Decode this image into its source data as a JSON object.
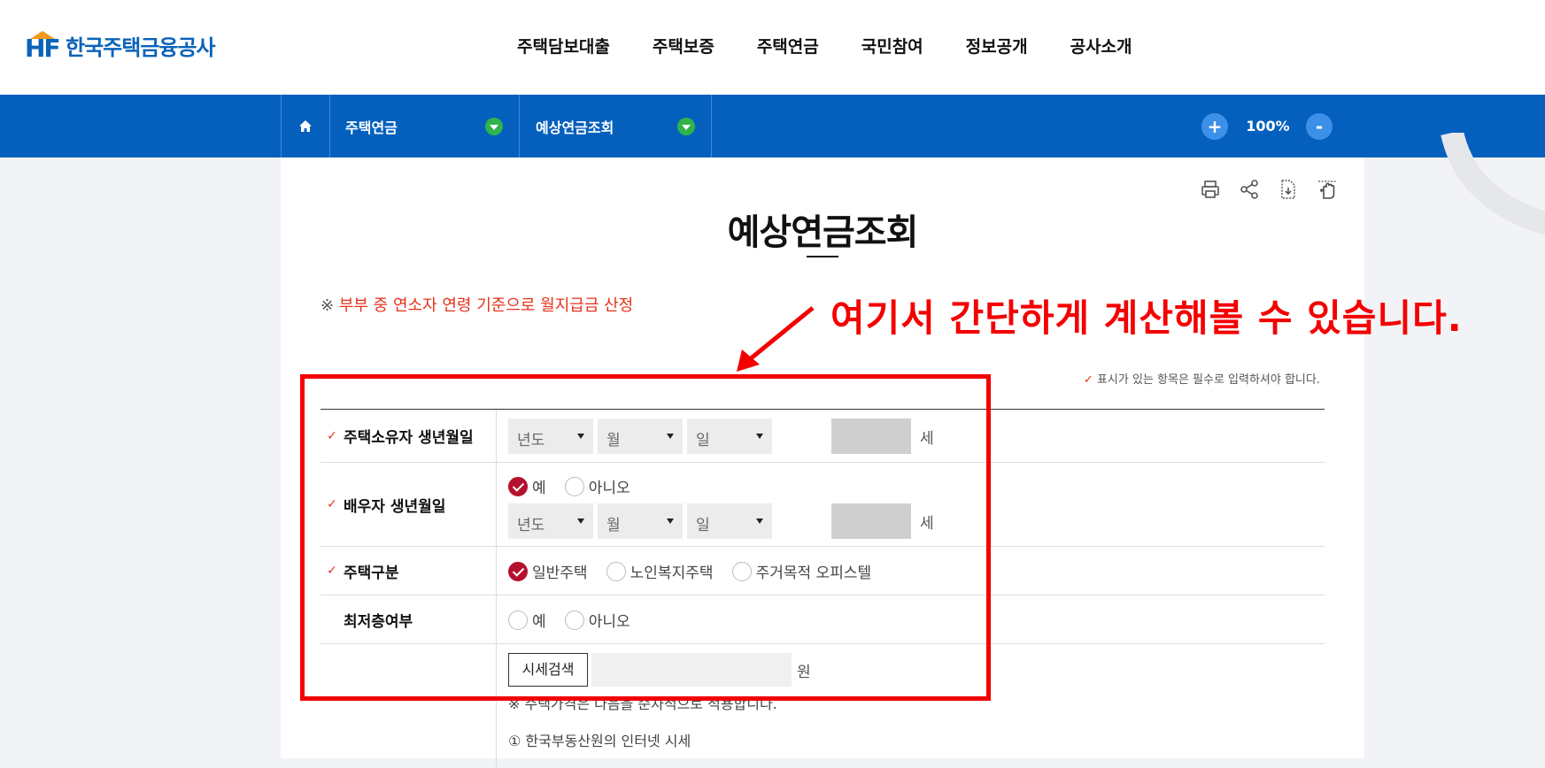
{
  "header": {
    "logo_mark": "HF",
    "logo_text": "한국주택금융공사",
    "nav": [
      "주택담보대출",
      "주택보증",
      "주택연금",
      "국민참여",
      "정보공개",
      "공사소개"
    ]
  },
  "location": {
    "menu1": "주택연금",
    "menu2": "예상연금조회",
    "zoom_in": "+",
    "zoom_level": "100%",
    "zoom_out": "-"
  },
  "page": {
    "title": "예상연금조회",
    "notice_mark": "※",
    "notice": "부부 중 연소자 연령 기준으로 월지급금 산정",
    "required_note_check": "✓",
    "required_note": "표시가 있는 항목은 필수로 입력하셔야 합니다."
  },
  "form": {
    "owner_birth": {
      "label": "주택소유자 생년월일",
      "year": "년도",
      "month": "월",
      "day": "일",
      "age_unit": "세"
    },
    "spouse_birth": {
      "label": "배우자 생년월일",
      "opt_yes": "예",
      "opt_no": "아니오",
      "year": "년도",
      "month": "월",
      "day": "일",
      "age_unit": "세"
    },
    "house_type": {
      "label": "주택구분",
      "opt1": "일반주택",
      "opt2": "노인복지주택",
      "opt3": "주거목적 오피스텔"
    },
    "lowest_floor": {
      "label": "최저층여부",
      "opt_yes": "예",
      "opt_no": "아니오"
    },
    "price": {
      "search_button": "시세검색",
      "unit": "원",
      "note": "※ 주택가격은 다음을 순차적으로 적용합니다.",
      "item1": "① 한국부동산원의 인터넷 시세"
    }
  },
  "annotation": {
    "text": "여기서 간단하게 계산해볼 수 있습니다."
  },
  "colors": {
    "brand_blue": "#0560bd",
    "accent_green": "#31b34b",
    "required_red": "#e8311b",
    "radio_selected": "#b5102d",
    "annotation_red": "#f40000"
  }
}
